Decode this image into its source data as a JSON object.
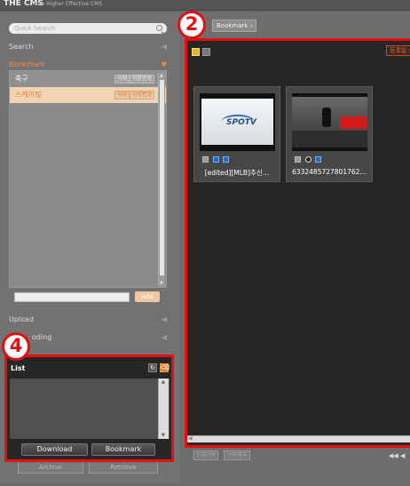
{
  "app": {
    "title": "THE CMS",
    "subtitle": "The Higher Effective CMS"
  },
  "search": {
    "placeholder": "Quick Search"
  },
  "sidebar": {
    "search_label": "Search",
    "bookmark_label": "Bookmark",
    "upload_label": "Upload",
    "encoding_label": "oding"
  },
  "bookmarks": [
    {
      "name": "축구",
      "btn1": "삭제",
      "btn2": "이름변경"
    },
    {
      "name": "스케이팅",
      "btn1": "삭제",
      "btn2": "이름변경"
    }
  ],
  "add_button": "Add",
  "list_panel": {
    "badge": "4",
    "title": "List",
    "download": "Download",
    "bookmark": "Bookmark"
  },
  "bottom_left": {
    "archive": "Archive",
    "retrieve": "Retrieve"
  },
  "right": {
    "badge": "2",
    "tab": {
      "label": "Bookmark",
      "close": "x"
    },
    "sort_button": "등록일 순",
    "cards": [
      {
        "caption": "[edited][MLB]추신…",
        "thumb_logo": "SPOTV"
      },
      {
        "caption": "6332485727801762…"
      }
    ],
    "bottom_buttons": [
      "전체선택",
      "선택해제"
    ],
    "pager": "◀◀ ◀"
  },
  "colors": {
    "highlight": "#e41010",
    "accent": "#f08a3c"
  }
}
